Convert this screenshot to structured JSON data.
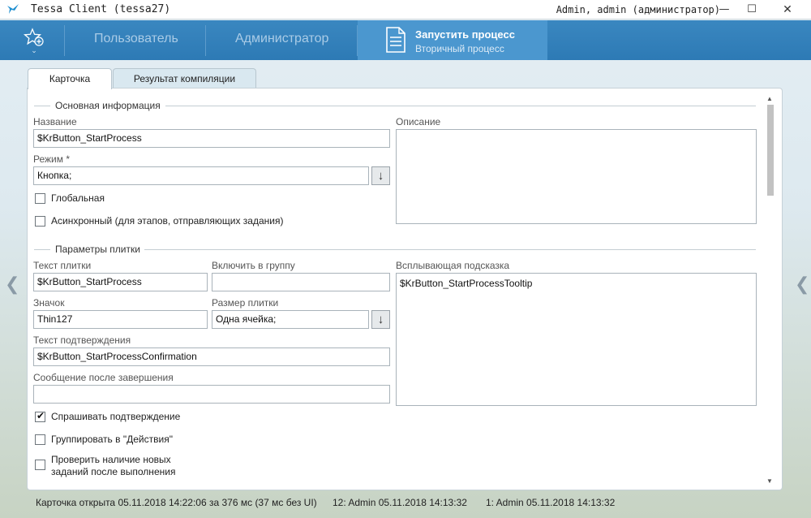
{
  "window": {
    "title": "Tessa Client (tessa27)",
    "user": "Admin, admin (администратор)",
    "min_glyph": "—",
    "max_glyph": "☐",
    "close_glyph": "✕"
  },
  "nav": {
    "fav_icon": "star-add-icon",
    "tabs": [
      "Пользователь",
      "Администратор"
    ],
    "active": {
      "title": "Запустить процесс",
      "subtitle": "Вторичный процесс"
    }
  },
  "card_tabs": [
    "Карточка",
    "Результат компиляции"
  ],
  "sections": {
    "main_info": "Основная информация",
    "tile_params": "Параметры плитки"
  },
  "fields": {
    "name": {
      "label": "Название",
      "value": "$KrButton_StartProcess"
    },
    "mode": {
      "label": "Режим  *",
      "value": "Кнопка;"
    },
    "description": {
      "label": "Описание",
      "value": ""
    },
    "global": {
      "label": "Глобальная",
      "checked": false
    },
    "async": {
      "label": "Асинхронный (для этапов, отправляющих задания)",
      "checked": false
    },
    "tile_text": {
      "label": "Текст плитки",
      "value": "$KrButton_StartProcess"
    },
    "group": {
      "label": "Включить в группу",
      "value": ""
    },
    "tooltip": {
      "label": "Всплывающая подсказка",
      "value": "$KrButton_StartProcessTooltip"
    },
    "icon": {
      "label": "Значок",
      "value": "Thin127"
    },
    "tile_size": {
      "label": "Размер плитки",
      "value": "Одна ячейка;"
    },
    "confirmation": {
      "label": "Текст подтверждения",
      "value": "$KrButton_StartProcessConfirmation"
    },
    "after_msg": {
      "label": "Сообщение после завершения",
      "value": ""
    },
    "ask_confirm": {
      "label": "Спрашивать подтверждение",
      "checked": true
    },
    "group_actions": {
      "label": "Группировать в \"Действия\"",
      "checked": false
    },
    "check_new_tasks": {
      "label_line1": "Проверить наличие новых",
      "label_line2": "заданий после выполнения",
      "checked": false
    }
  },
  "status": {
    "opened": "Карточка открыта 05.11.2018 14:22:06 за 376 мс (37 мс без UI)",
    "v12": "12:  Admin  05.11.2018 14:13:32",
    "v1": "1:  Admin  05.11.2018 14:13:32"
  },
  "colors": {
    "nav": "#3a87c0",
    "nav_active": "#4b97cf",
    "accent": "#1f8fd0"
  }
}
